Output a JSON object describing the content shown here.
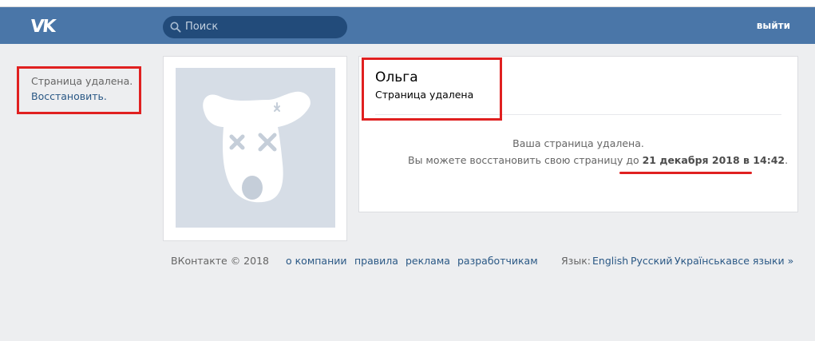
{
  "header": {
    "logo": "VK",
    "search_placeholder": "Поиск",
    "logout_label": "выйти"
  },
  "sidebar": {
    "status_text": "Страница удалена.",
    "restore_link": "Восстановить."
  },
  "profile": {
    "name": "Ольга",
    "status": "Страница удалена",
    "message_line1": "Ваша страница удалена.",
    "message_line2_prefix": "Вы можете восстановить свою страницу до",
    "message_line2_date": "21 декабря 2018 в 14:42",
    "message_line2_suffix": "."
  },
  "footer": {
    "copyright": "ВКонтакте © 2018",
    "links": [
      "о компании",
      "правила",
      "реклама",
      "разработчикам"
    ],
    "language_label": "Язык:",
    "languages": [
      "English",
      "Русский",
      "Українська",
      "все языки »"
    ]
  },
  "colors": {
    "header_bg": "#4a76a8",
    "search_bg": "#224b7a",
    "link": "#2a5885",
    "annotation_red": "#e02020",
    "page_bg": "#edeef0"
  },
  "icons": {
    "search": "search-icon",
    "avatar": "deleted-dog-avatar-icon"
  }
}
